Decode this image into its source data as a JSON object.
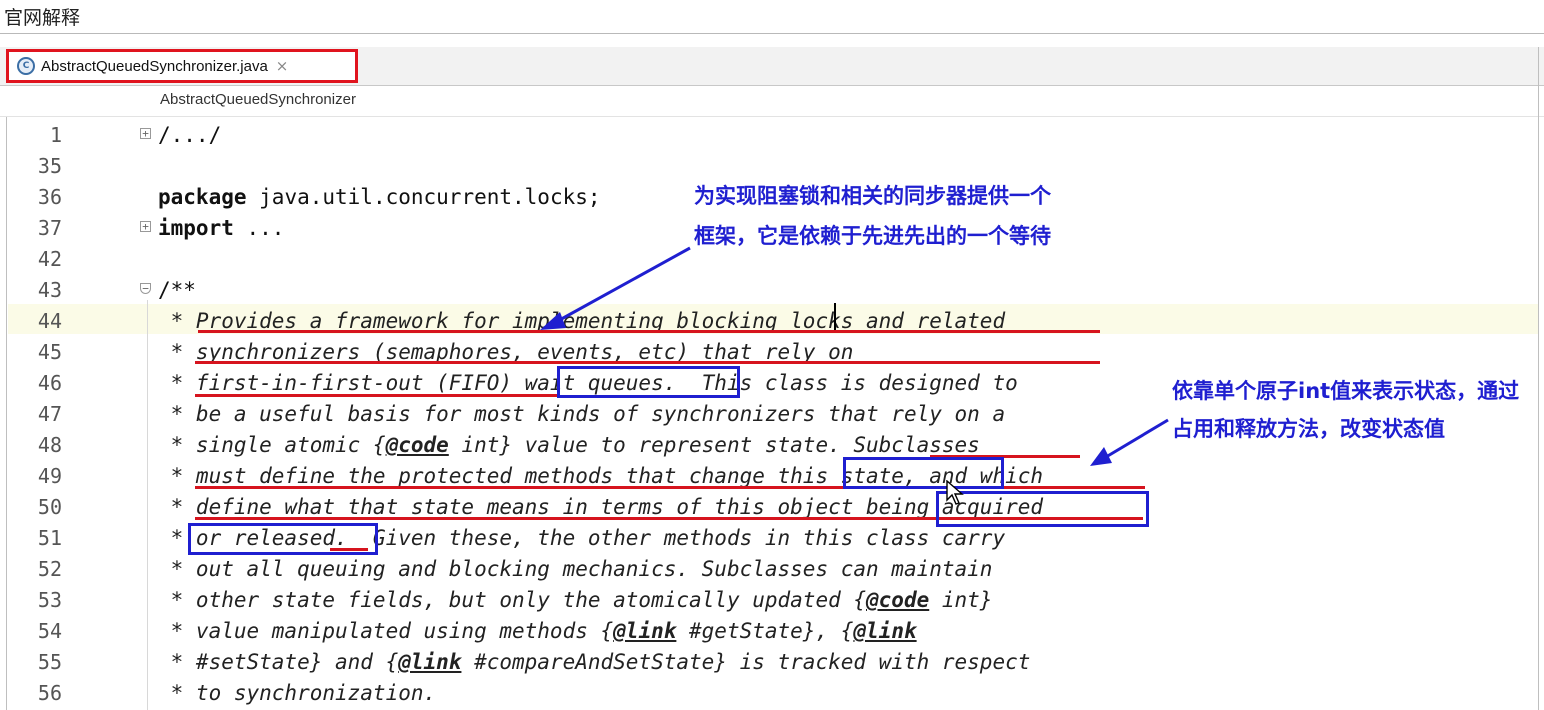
{
  "page": {
    "title": "官网解释"
  },
  "tab": {
    "icon": "java-class-icon",
    "icon_text": "C",
    "label": "AbstractQueuedSynchronizer.java",
    "close": "×"
  },
  "breadcrumb": {
    "label": "AbstractQueuedSynchronizer"
  },
  "code_lines": [
    {
      "num": "1",
      "text": "/.../"
    },
    {
      "num": "35",
      "text": ""
    },
    {
      "num": "36",
      "kw": "package",
      "text": " java.util.concurrent.locks;"
    },
    {
      "num": "37",
      "kw": "import",
      "text": " ..."
    },
    {
      "num": "42",
      "text": ""
    },
    {
      "num": "43",
      "text": "/**"
    },
    {
      "num": "44",
      "text": " * Provides a framework for implementing blocking locks and related"
    },
    {
      "num": "45",
      "text": " * synchronizers (semaphores, events, etc) that rely on"
    },
    {
      "num": "46",
      "text": " * first-in-first-out (FIFO) wait queues.  This class is designed to"
    },
    {
      "num": "47",
      "text": " * be a useful basis for most kinds of synchronizers that rely on a"
    },
    {
      "num": "48",
      "pre": " * single atomic {",
      "tag": "@code",
      "post": " int} value to represent state. Subclasses"
    },
    {
      "num": "49",
      "text": " * must define the protected methods that change this state, and which"
    },
    {
      "num": "50",
      "text": " * define what that state means in terms of this object being acquired"
    },
    {
      "num": "51",
      "text": " * or released.  Given these, the other methods in this class carry"
    },
    {
      "num": "52",
      "text": " * out all queuing and blocking mechanics. Subclasses can maintain"
    },
    {
      "num": "53",
      "pre": " * other state fields, but only the atomically updated {",
      "tag": "@code",
      "post": " int}"
    },
    {
      "num": "54",
      "pre": " * value manipulated using methods {",
      "tag": "@link",
      "post": " #getState}, {",
      "tag2": "@link",
      "post2": ""
    },
    {
      "num": "55",
      "pre": " * #setState} and {",
      "tag": "@link",
      "post": " #compareAndSetState} is tracked with respect"
    },
    {
      "num": "56",
      "text": " * to synchronization."
    }
  ],
  "annotations": {
    "note1_line1": "为实现阻塞锁和相关的同步器提供一个",
    "note1_line2": "框架，它是依赖于先进先出的一个等待",
    "note2_line1": "依靠单个原子int值来表示状态，通过",
    "note2_line2": "占用和释放方法，改变状态值",
    "underline_color": "#d6141e",
    "box_color": "#1f1fd0",
    "tab_highlight_color": "#e0141e"
  }
}
